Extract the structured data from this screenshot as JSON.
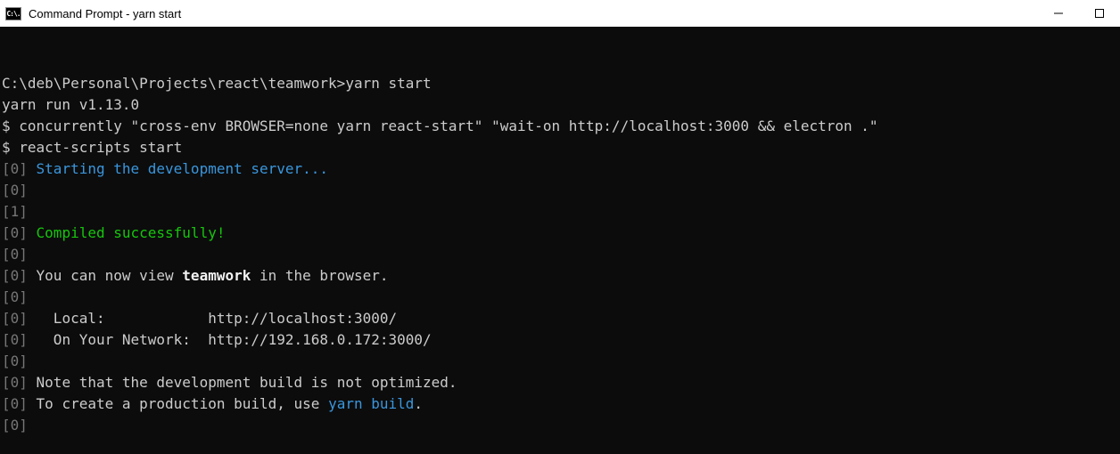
{
  "window": {
    "icon_label": "C:\\.",
    "title": "Command Prompt - yarn  start"
  },
  "term": {
    "blank": "",
    "prompt_path": "C:\\deb\\Personal\\Projects\\react\\teamwork>",
    "prompt_cmd": "yarn start",
    "line_yarn_run": "yarn run v1.13.0",
    "line_concurrently": "$ concurrently \"cross-env BROWSER=none yarn react-start\" \"wait-on http://localhost:3000 && electron .\"",
    "line_react_scripts": "$ react-scripts start",
    "idx0": "[0]",
    "idx1": "[1]",
    "msg_starting": " Starting the development server...",
    "msg_compiled": " Compiled successfully!",
    "msg_view_pre": " You can now view ",
    "msg_view_app": "teamwork",
    "msg_view_post": " in the browser.",
    "msg_local": "   Local:            http://localhost:3000/",
    "msg_network": "   On Your Network:  http://192.168.0.172:3000/",
    "msg_note": " Note that the development build is not optimized.",
    "msg_prod_pre": " To create a production build, use ",
    "msg_prod_cmd": "yarn build",
    "msg_prod_post": "."
  }
}
